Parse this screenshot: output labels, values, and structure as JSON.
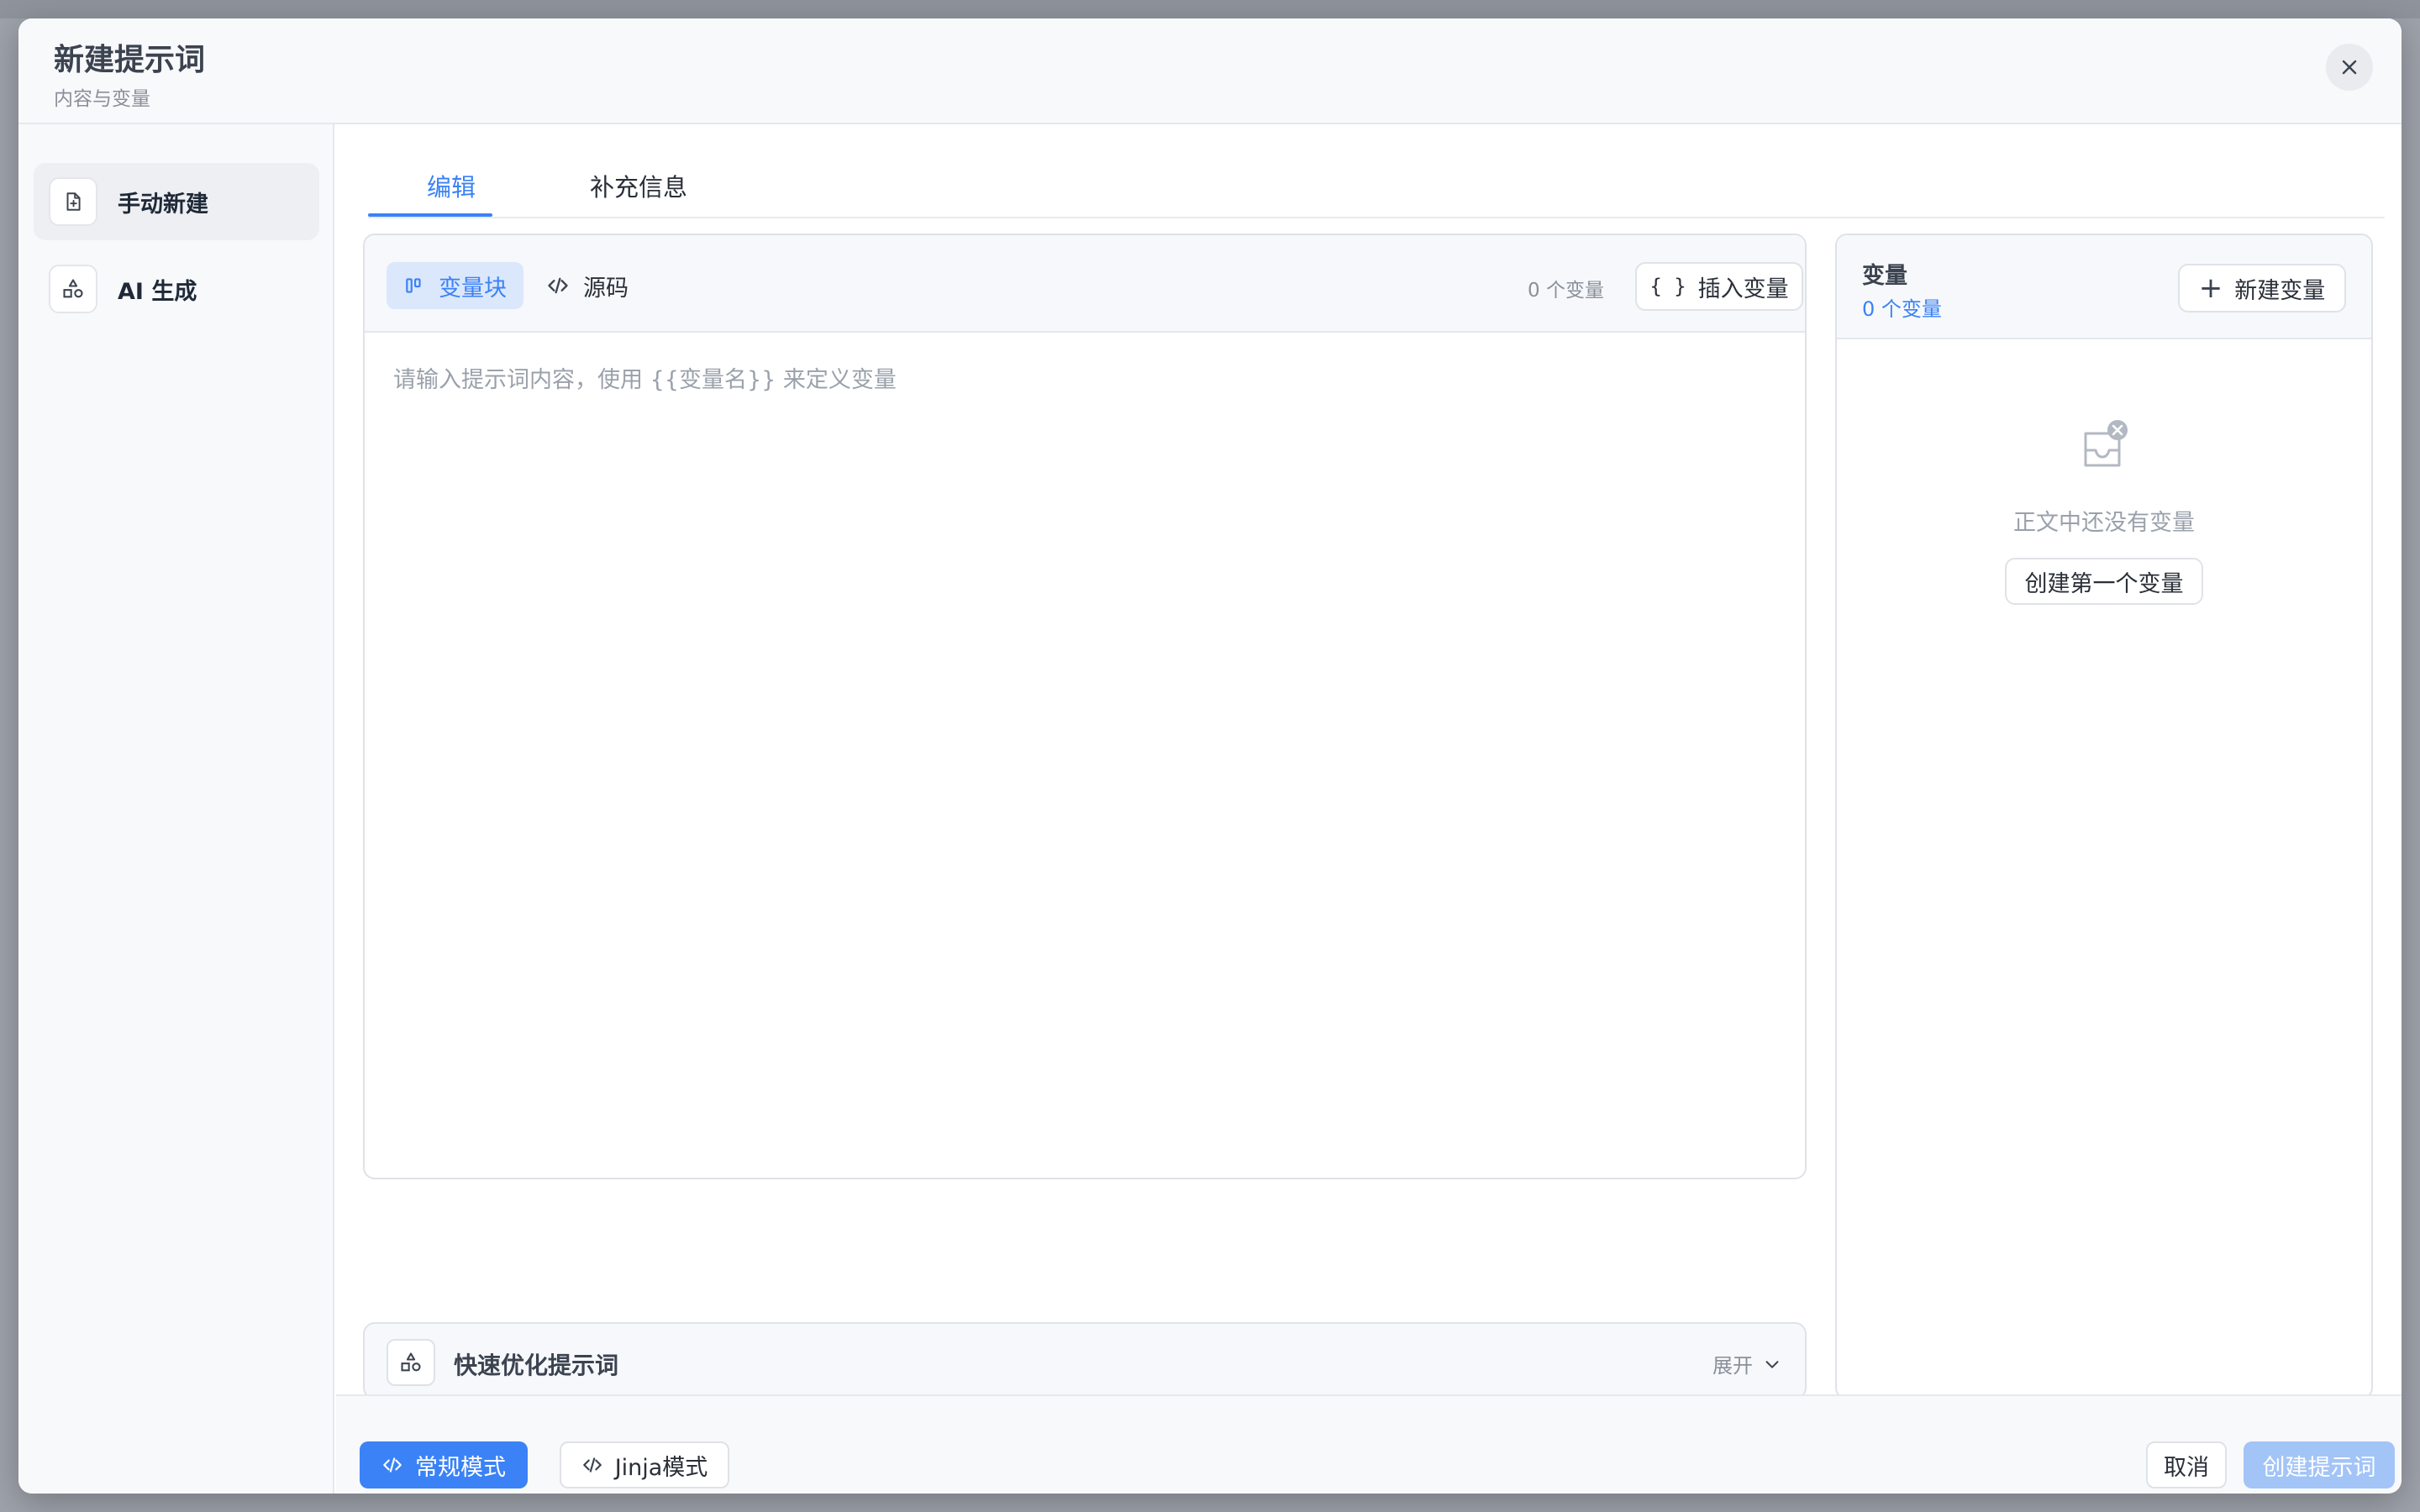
{
  "modal": {
    "title": "新建提示词",
    "subtitle": "内容与变量"
  },
  "sidebar": {
    "items": [
      {
        "label": "手动新建",
        "icon": "file-plus-icon",
        "active": true
      },
      {
        "label": "AI 生成",
        "icon": "shapes-icon",
        "active": false
      }
    ]
  },
  "tabs": [
    {
      "label": "编辑",
      "active": true
    },
    {
      "label": "补充信息",
      "active": false
    }
  ],
  "editor": {
    "modes": [
      {
        "label": "变量块",
        "icon": "variable-block-icon",
        "active": true
      },
      {
        "label": "源码",
        "icon": "code-icon",
        "active": false
      }
    ],
    "variable_count": "0 个变量",
    "insert_label": "插入变量",
    "value": "",
    "placeholder": "请输入提示词内容，使用 {{变量名}} 来定义变量"
  },
  "quick_optimize": {
    "label": "快速优化提示词",
    "expand_label": "展开"
  },
  "variables_panel": {
    "title": "变量",
    "count": "0 个变量",
    "new_label": "新建变量",
    "empty_text": "正文中还没有变量",
    "create_first_label": "创建第一个变量"
  },
  "footer": {
    "normal_mode_label": "常规模式",
    "jinja_mode_label": "Jinja模式",
    "cancel_label": "取消",
    "create_label": "创建提示词"
  },
  "colors": {
    "accent": "#3b82f6",
    "accent_light": "#dbe7fb",
    "disabled_primary": "#a3c4f7"
  }
}
